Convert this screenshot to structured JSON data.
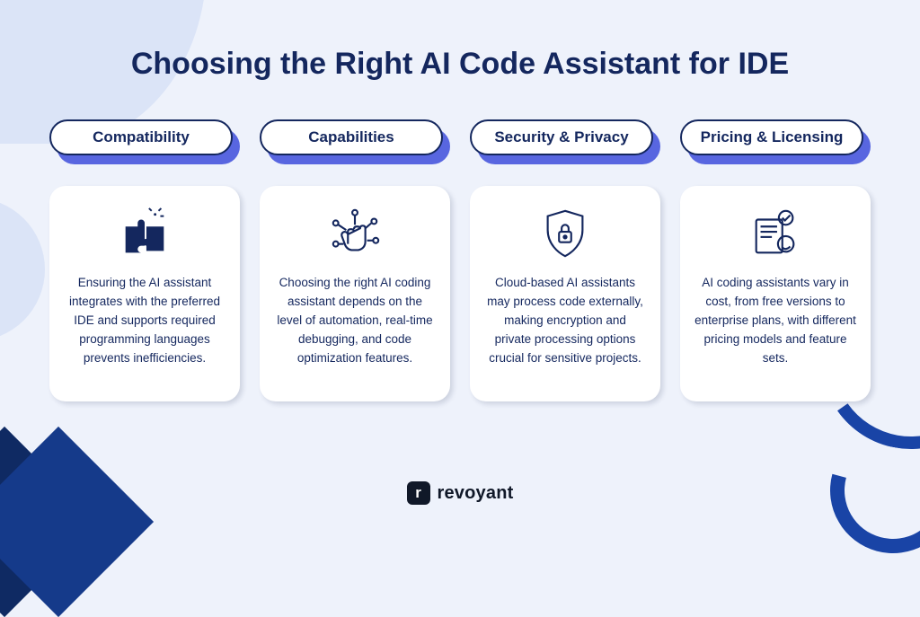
{
  "title": "Choosing the Right AI Code Assistant for IDE",
  "columns": [
    {
      "heading": "Compatibility",
      "icon": "puzzle-icon",
      "body": "Ensuring the AI assistant integrates with the preferred IDE and supports required programming languages prevents inefficiencies."
    },
    {
      "heading": "Capabilities",
      "icon": "ai-fist-icon",
      "body": "Choosing the right AI coding assistant depends on the level of automation, real-time debugging, and code optimization features."
    },
    {
      "heading": "Security & Privacy",
      "icon": "shield-lock-icon",
      "body": "Cloud-based AI assistants may process code externally, making encryption and private processing options crucial for sensitive projects."
    },
    {
      "heading": "Pricing & Licensing",
      "icon": "contract-stamp-icon",
      "body": "AI coding assistants vary in cost, from free versions to enterprise plans, with different pricing models and feature sets."
    }
  ],
  "brand": {
    "mark": "r",
    "name": "revoyant"
  },
  "colors": {
    "navy": "#14275e",
    "accent": "#5866e0",
    "bg": "#eef2fb"
  }
}
